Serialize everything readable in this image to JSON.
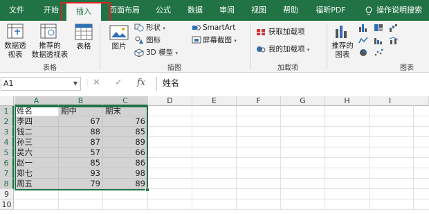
{
  "tabs": [
    {
      "label": "文件"
    },
    {
      "label": "开始"
    },
    {
      "label": "插入"
    },
    {
      "label": "页面布局"
    },
    {
      "label": "公式"
    },
    {
      "label": "数据"
    },
    {
      "label": "审阅"
    },
    {
      "label": "视图"
    },
    {
      "label": "帮助"
    },
    {
      "label": "福昕PDF"
    }
  ],
  "tell_me": "操作说明搜索",
  "ribbon": {
    "tables": {
      "pivot": "数据透\n视表",
      "pivot_caret": "⌄",
      "recommended_pivot": "推荐的\n数据透视表",
      "table": "表格",
      "group": "表格"
    },
    "illustrations": {
      "pictures": "图片",
      "pictures_caret": "⌄",
      "shapes": "形状",
      "icons": "图标",
      "models": "3D 模型",
      "smartart": "SmartArt",
      "screenshot": "屏幕截图",
      "group": "插图"
    },
    "addins": {
      "get": "获取加载项",
      "mine": "我的加载项",
      "group": "加载项"
    },
    "charts": {
      "recommended": "推荐的\n图表",
      "group": "图表"
    },
    "colors": {
      "green": "#217346",
      "highlight": "#e02020"
    }
  },
  "formula_bar": {
    "name_box": "A1",
    "fx": "fx",
    "cancel": "✕",
    "enter": "✓",
    "value": "姓名"
  },
  "grid": {
    "columns": [
      "A",
      "B",
      "C",
      "D",
      "E",
      "F",
      "G",
      "H",
      "I"
    ],
    "rows": [
      {
        "num": "1",
        "a": "姓名",
        "b": "期中",
        "c": "期末"
      },
      {
        "num": "2",
        "a": "李四",
        "b": "67",
        "c": "76"
      },
      {
        "num": "3",
        "a": "钱二",
        "b": "88",
        "c": "85"
      },
      {
        "num": "4",
        "a": "孙三",
        "b": "87",
        "c": "89"
      },
      {
        "num": "5",
        "a": "吴六",
        "b": "57",
        "c": "66"
      },
      {
        "num": "6",
        "a": "赵一",
        "b": "85",
        "c": "86"
      },
      {
        "num": "7",
        "a": "郑七",
        "b": "93",
        "c": "98"
      },
      {
        "num": "8",
        "a": "周五",
        "b": "79",
        "c": "89"
      },
      {
        "num": "9",
        "a": "",
        "b": "",
        "c": ""
      },
      {
        "num": "10",
        "a": "",
        "b": "",
        "c": ""
      }
    ]
  }
}
